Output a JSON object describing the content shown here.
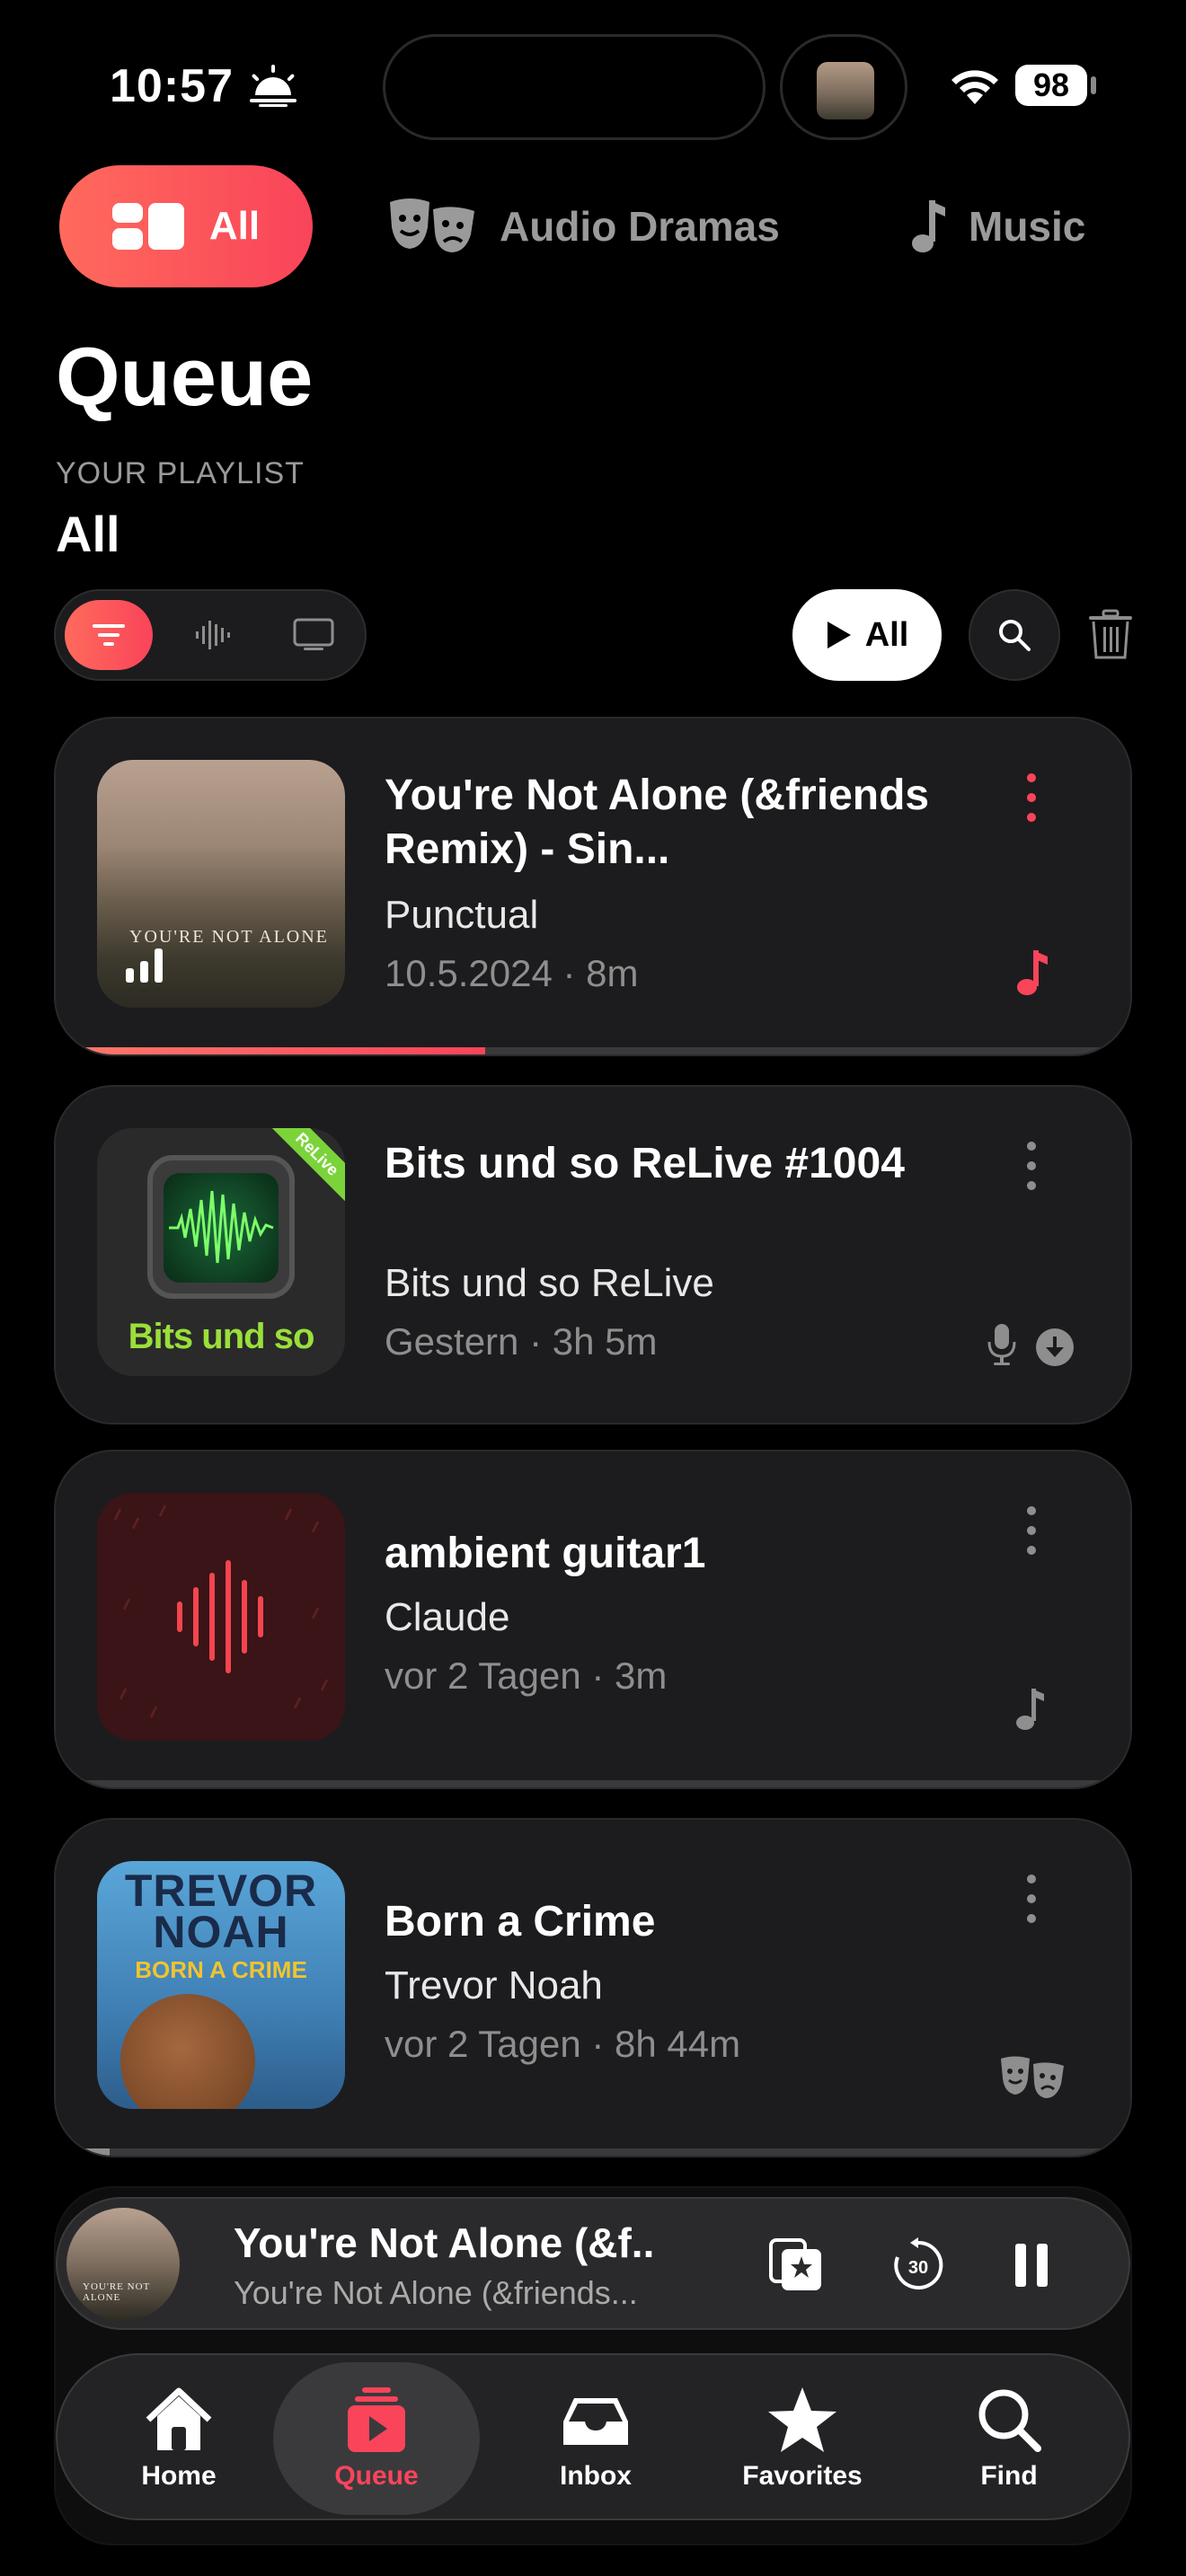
{
  "status": {
    "time": "10:57",
    "battery": "98"
  },
  "categories": {
    "all": "All",
    "audio_dramas": "Audio Dramas",
    "music": "Music"
  },
  "header": {
    "title": "Queue",
    "playlist_caption": "YOUR PLAYLIST",
    "playlist_name": "All"
  },
  "actions": {
    "play_all_label": "All"
  },
  "colors": {
    "accent": "#f9445a",
    "accent_light": "#ff6a5c",
    "background": "#000000",
    "card": "#1c1c1e"
  },
  "queue": [
    {
      "title": "You're Not Alone (&friends Remix) - Sin...",
      "author": "Punctual",
      "meta": "10.5.2024 · 8m",
      "art_text": "YOU'RE NOT ALONE",
      "type_icon": "music-note-icon",
      "progress": 0.4
    },
    {
      "title": "Bits und so ReLive #1004",
      "author": "Bits und so ReLive",
      "meta": "Gestern · 3h 5m",
      "art_text": "Bits und so",
      "art_badge": "ReLive",
      "type_icon": "microphone-icon",
      "progress": 0
    },
    {
      "title": "ambient guitar1",
      "author": "Claude",
      "meta": "vor 2 Tagen · 3m",
      "type_icon": "music-note-icon",
      "progress": 0
    },
    {
      "title": "Born a Crime",
      "author": "Trevor Noah",
      "meta": "vor 2 Tagen · 8h 44m",
      "art_text": "TREVOR NOAH",
      "art_subtext": "BORN A CRIME",
      "type_icon": "theater-masks-icon",
      "progress": 0.05
    }
  ],
  "mini_player": {
    "title": "You're Not Alone (&f...",
    "subtitle": "You're Not Alone (&friends...",
    "art_text": "YOU'RE NOT ALONE",
    "skip_seconds": "30"
  },
  "tabs": [
    {
      "label": "Home",
      "icon": "house-icon"
    },
    {
      "label": "Queue",
      "icon": "queue-icon"
    },
    {
      "label": "Inbox",
      "icon": "inbox-icon"
    },
    {
      "label": "Favorites",
      "icon": "star-icon"
    },
    {
      "label": "Find",
      "icon": "search-icon"
    }
  ]
}
